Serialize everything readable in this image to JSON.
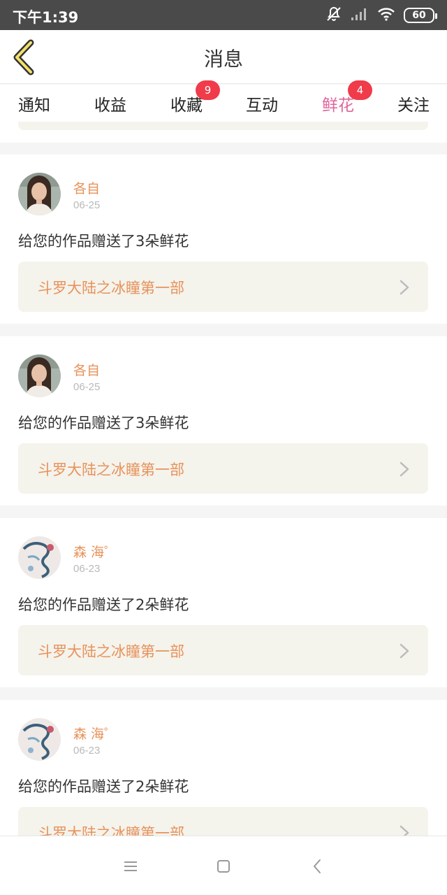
{
  "status_bar": {
    "time": "下午1:39",
    "battery": "60"
  },
  "header": {
    "title": "消息"
  },
  "tabs": [
    {
      "label": "通知"
    },
    {
      "label": "收益"
    },
    {
      "label": "收藏",
      "badge": "9"
    },
    {
      "label": "互动"
    },
    {
      "label": "鲜花",
      "badge": "4",
      "active": true
    },
    {
      "label": "关注"
    }
  ],
  "accent_colors": {
    "active_tab": "#e0649c",
    "name": "#e8925a",
    "badge": "#f03b4a"
  },
  "messages": [
    {
      "user": "各自",
      "date": "06-25",
      "text": "给您的作品赠送了3朵鲜花",
      "work": "斗罗大陆之冰瞳第一部",
      "avatar": "girl-portrait"
    },
    {
      "user": "各自",
      "date": "06-25",
      "text": "给您的作品赠送了3朵鲜花",
      "work": "斗罗大陆之冰瞳第一部",
      "avatar": "girl-portrait"
    },
    {
      "user": "森 海゜",
      "date": "06-23",
      "text": "给您的作品赠送了2朵鲜花",
      "work": "斗罗大陆之冰瞳第一部",
      "avatar": "ink-art"
    },
    {
      "user": "森 海゜",
      "date": "06-23",
      "text": "给您的作品赠送了2朵鲜花",
      "work": "斗罗大陆之冰瞳第一部",
      "avatar": "ink-art"
    }
  ],
  "nav_icons": [
    "menu-icon",
    "home-square-icon",
    "back-triangle-icon"
  ]
}
